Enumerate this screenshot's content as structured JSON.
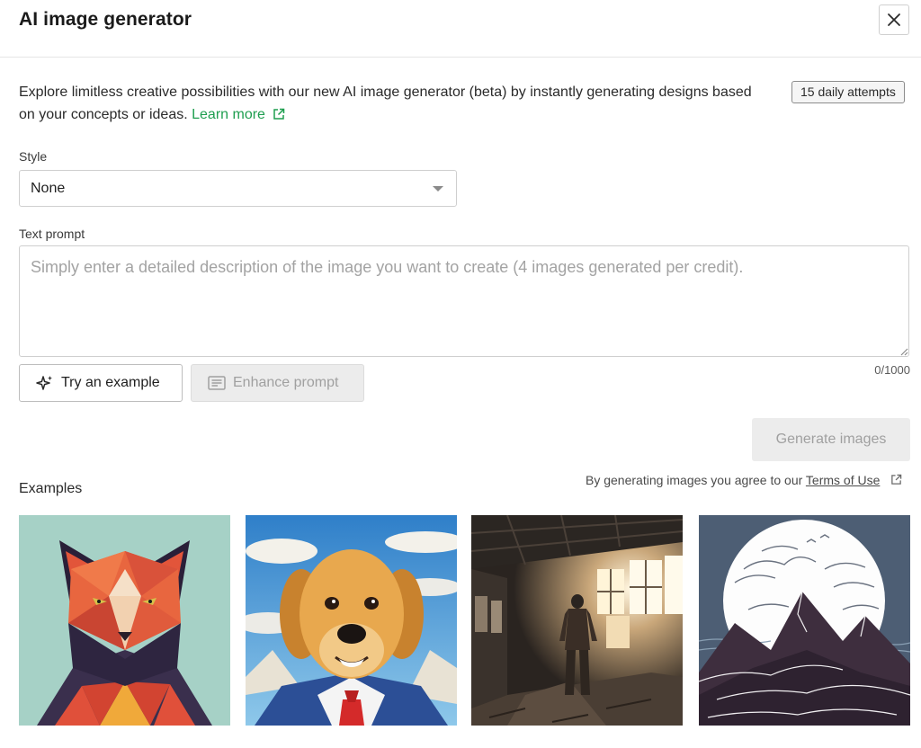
{
  "dialog": {
    "title": "AI image generator",
    "close_icon": "close-icon"
  },
  "intro": {
    "text": "Explore limitless creative possibilities with our new AI image generator (beta) by instantly generating designs based on your concepts or ideas.",
    "learn_more": "Learn more",
    "learn_more_icon": "external-link-icon",
    "attempts_badge": "15 daily attempts"
  },
  "style": {
    "label": "Style",
    "selected": "None"
  },
  "prompt": {
    "label": "Text prompt",
    "placeholder": "Simply enter a detailed description of the image you want to create (4 images generated per credit).",
    "value": "",
    "char_count": "0/1000"
  },
  "buttons": {
    "try_example": "Try an example",
    "try_example_icon": "sparkle-icon",
    "enhance_prompt": "Enhance prompt",
    "enhance_prompt_icon": "text-lines-icon",
    "generate": "Generate images"
  },
  "terms": {
    "text": "By generating images you agree to our",
    "link": "Terms of Use",
    "icon": "external-link-icon"
  },
  "examples": {
    "label": "Examples",
    "items": [
      {
        "name": "low-poly-fox-example"
      },
      {
        "name": "dog-in-suit-example"
      },
      {
        "name": "abandoned-warehouse-example"
      },
      {
        "name": "mountains-moon-example"
      }
    ]
  },
  "colors": {
    "accent_green": "#1e9e4f",
    "disabled_bg": "#ececec",
    "disabled_text": "#a0a0a0",
    "border": "#cfcfcf"
  }
}
